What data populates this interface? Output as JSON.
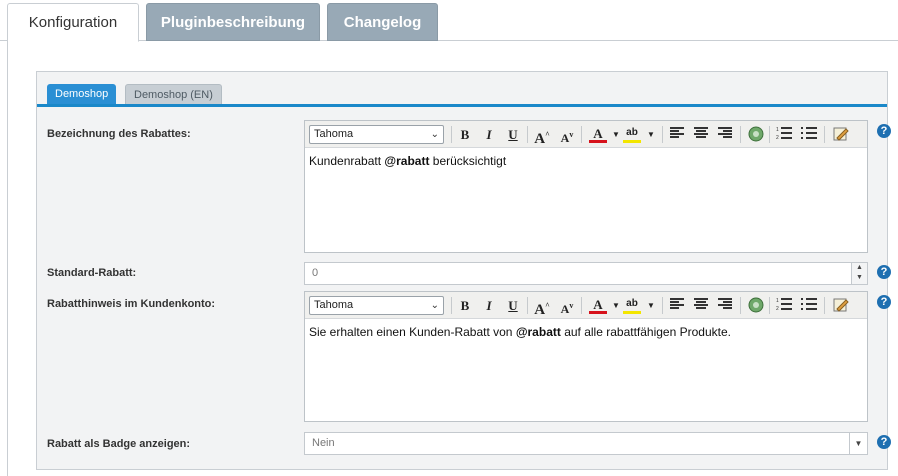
{
  "tabs": {
    "active": "Konfiguration",
    "items": [
      "Pluginbeschreibung",
      "Changelog"
    ]
  },
  "shop_tabs": {
    "active": "Demoshop",
    "inactive": "Demoshop (EN)"
  },
  "fields": {
    "discount_name": {
      "label": "Bezeichnung des Rabattes:",
      "font": "Tahoma",
      "text_before": "Kundenrabatt ",
      "text_bold": "@rabatt",
      "text_after": " berücksichtigt"
    },
    "standard_discount": {
      "label": "Standard-Rabatt:",
      "value": "0"
    },
    "account_hint": {
      "label": "Rabatthinweis im Kundenkonto:",
      "font": "Tahoma",
      "text_before": "Sie erhalten einen Kunden-Rabatt von ",
      "text_bold": "@rabatt",
      "text_after": " auf alle rabattfähigen Produkte."
    },
    "badge": {
      "label": "Rabatt als Badge anzeigen:",
      "value": "Nein"
    }
  },
  "help_glyph": "?",
  "toolbar_icons": [
    "bold-icon",
    "italic-icon",
    "underline-icon",
    "font-size-increase-icon",
    "font-size-decrease-icon",
    "text-color-icon",
    "highlight-color-icon",
    "align-left-icon",
    "align-center-icon",
    "align-right-icon",
    "insert-image-icon",
    "ordered-list-icon",
    "unordered-list-icon",
    "source-edit-icon"
  ],
  "colors": {
    "accent": "#1a88c9",
    "inactive_tab": "#98a9b6",
    "text_color_bar": "#d6121c",
    "highlight_bar": "#f3e600",
    "help_icon": "#1e6fb1"
  }
}
